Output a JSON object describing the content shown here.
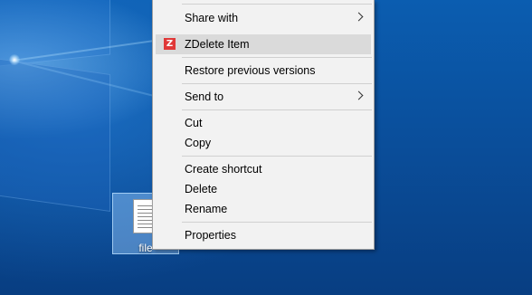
{
  "desktop": {
    "file": {
      "label": "file"
    }
  },
  "context_menu": {
    "items": [
      {
        "label": "Share with",
        "submenu": true
      },
      {
        "label": "ZDelete Item",
        "icon": "zdelete-icon",
        "highlighted": true
      },
      {
        "label": "Restore previous versions"
      },
      {
        "label": "Send to",
        "submenu": true
      },
      {
        "label": "Cut"
      },
      {
        "label": "Copy"
      },
      {
        "label": "Create shortcut"
      },
      {
        "label": "Delete"
      },
      {
        "label": "Rename"
      },
      {
        "label": "Properties"
      }
    ]
  },
  "colors": {
    "menu_bg": "#f2f2f2",
    "menu_highlight": "#dadada",
    "zdelete_icon": "#e03838",
    "desktop_blue": "#0a4f9c"
  }
}
